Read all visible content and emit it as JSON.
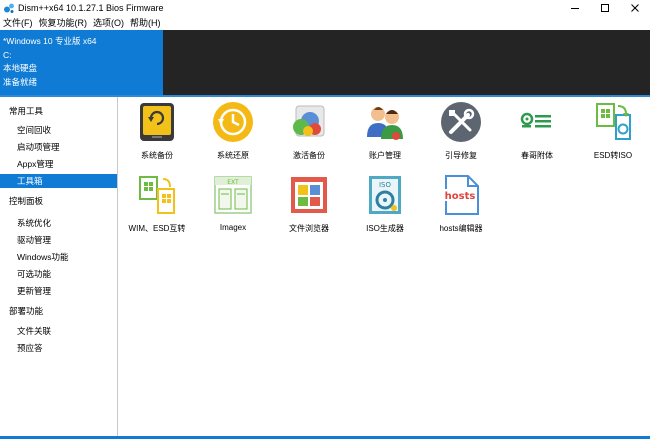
{
  "window": {
    "title": "Dism++x64 10.1.27.1 Bios Firmware",
    "accent": "#0f7bd4"
  },
  "menu": [
    "文件(F)",
    "恢复功能(R)",
    "选项(O)",
    "帮助(H)"
  ],
  "header": {
    "lines": [
      "*Windows 10 专业版 x64",
      "C:",
      "本地硬盘",
      "准备就绪"
    ]
  },
  "sidebar": [
    {
      "label": "常用工具",
      "kind": "category",
      "selected": false
    },
    {
      "label": "空间回收",
      "kind": "item",
      "selected": false
    },
    {
      "label": "启动项管理",
      "kind": "item",
      "selected": false
    },
    {
      "label": "Appx管理",
      "kind": "item",
      "selected": false
    },
    {
      "label": "工具箱",
      "kind": "item",
      "selected": true
    },
    {
      "label": "控制面板",
      "kind": "category",
      "selected": false
    },
    {
      "label": "系统优化",
      "kind": "item",
      "selected": false
    },
    {
      "label": "驱动管理",
      "kind": "item",
      "selected": false
    },
    {
      "label": "Windows功能",
      "kind": "item",
      "selected": false
    },
    {
      "label": "可选功能",
      "kind": "item",
      "selected": false
    },
    {
      "label": "更新管理",
      "kind": "item",
      "selected": false
    },
    {
      "label": "部署功能",
      "kind": "category",
      "selected": false
    },
    {
      "label": "文件关联",
      "kind": "item",
      "selected": false
    },
    {
      "label": "预应答",
      "kind": "item",
      "selected": false
    }
  ],
  "tools": [
    {
      "label": "系统备份",
      "icon": "system-backup-icon"
    },
    {
      "label": "系统还原",
      "icon": "system-restore-icon"
    },
    {
      "label": "激活备份",
      "icon": "activation-backup-icon"
    },
    {
      "label": "账户管理",
      "icon": "account-management-icon"
    },
    {
      "label": "引导修复",
      "icon": "boot-repair-icon"
    },
    {
      "label": "春哥附体",
      "icon": "chunge-icon"
    },
    {
      "label": "ESD转ISO",
      "icon": "esd-to-iso-icon"
    },
    {
      "label": "WIM、ESD互转",
      "icon": "wim-esd-convert-icon"
    },
    {
      "label": "Imagex",
      "icon": "imagex-icon"
    },
    {
      "label": "文件浏览器",
      "icon": "file-browser-icon"
    },
    {
      "label": "ISO生成器",
      "icon": "iso-builder-icon"
    },
    {
      "label": "hosts编辑器",
      "icon": "hosts-editor-icon"
    }
  ],
  "icon_glyphs": {
    "iso": "ISO",
    "hosts": "hosts",
    "imagex_tag": "EXT"
  }
}
